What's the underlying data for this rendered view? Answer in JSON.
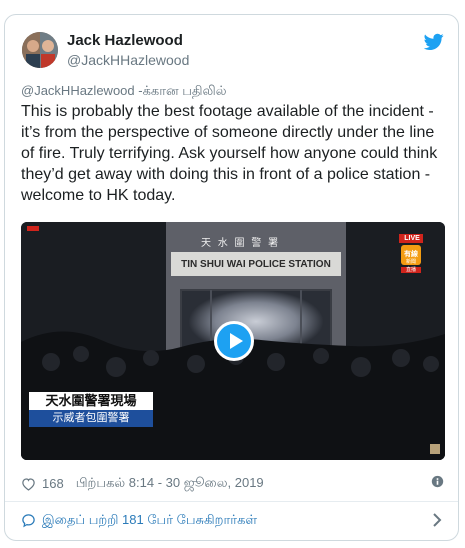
{
  "tweet": {
    "author_name": "Jack Hazlewood",
    "author_handle": "@JackHHazlewood",
    "reply_to": "@JackHHazlewood -க்கான பதிலில்",
    "text": "This is probably the best footage available of the incident - it’s from the perspective of someone directly under the line of fire. Truly terrifying. Ask yourself how anyone could think they’d get away with doing this in front of a police station - welcome to HK today.",
    "likes": "168",
    "timestamp": "பிற்பகல் 8:14 - 30 ஜூலை, 2019",
    "conversation_link": "இதைப் பற்றி 181 பேர் பேசுகிறார்கள்"
  },
  "video": {
    "building_sign": "TIN SHUI WAI POLICE STATION",
    "building_chars": "天 水 圍 警 署",
    "caption_main": "天水圍警署現場",
    "caption_sub": "示威者包圍警署",
    "live_label": "LIVE",
    "channel_logo": "有線",
    "channel_sub": "新聞",
    "channel_tag": "直播"
  },
  "colors": {
    "twitter_blue": "#1da1f2",
    "link_blue": "#2b7bb9",
    "muted_gray": "#697882",
    "caption_blue": "#1e4f9c",
    "live_red": "#d0241c"
  },
  "icons": [
    "twitter-bird-icon",
    "play-icon",
    "heart-icon",
    "info-icon",
    "speech-bubble-icon",
    "chevron-right-icon"
  ]
}
